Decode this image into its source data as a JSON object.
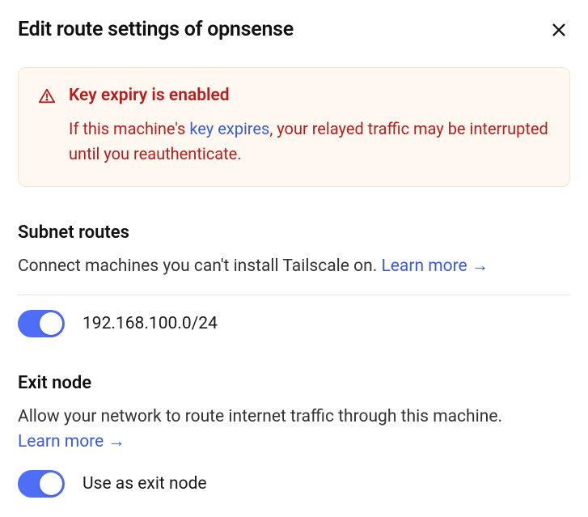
{
  "header": {
    "title": "Edit route settings of opnsense"
  },
  "warning": {
    "title": "Key expiry is enabled",
    "text_before": "If this machine's ",
    "link_text": "key expires",
    "text_after": ", your relayed traffic may be interrupted until you reauthenticate."
  },
  "subnet": {
    "title": "Subnet routes",
    "desc": "Connect machines you can't install Tailscale on. ",
    "learn_more": "Learn more",
    "routes": [
      {
        "cidr": "192.168.100.0/24",
        "enabled": true
      }
    ]
  },
  "exit_node": {
    "title": "Exit node",
    "desc": "Allow your network to route internet traffic through this machine. ",
    "learn_more": "Learn more",
    "toggle_label": "Use as exit node",
    "enabled": true
  }
}
